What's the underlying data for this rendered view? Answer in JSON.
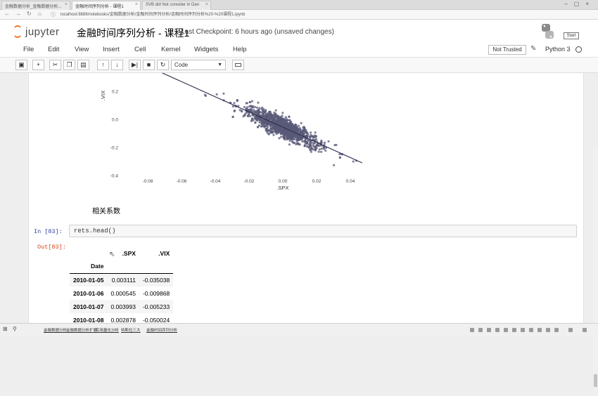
{
  "browser": {
    "tabs": [
      {
        "label": "金融数据分析_金融数据分析..."
      },
      {
        "label": "金融时间序列分析 - 课程1"
      },
      {
        "label": "SVB did Not consider in Dan"
      }
    ],
    "url": "localhost:8888/notebooks/金融数据分析/金融时间序列分析/金融时间序列分析%20-%20课程1.ipynb"
  },
  "jupyter": {
    "logo_text": "jupyter",
    "notebook_title": "金融时间序列分析 - 课程1",
    "checkpoint": "Last Checkpoint: 6 hours ago (unsaved changes)",
    "start_label": "Start",
    "menus": [
      "File",
      "Edit",
      "View",
      "Insert",
      "Cell",
      "Kernel",
      "Widgets",
      "Help"
    ],
    "trust_label": "Not Trusted",
    "kernel_name": "Python 3",
    "cell_type": "Code",
    "toolbar_icons": [
      "save-icon",
      "add-cell-icon",
      "cut-icon",
      "copy-icon",
      "paste-icon",
      "move-up-icon",
      "move-down-icon",
      "run-icon",
      "stop-icon",
      "restart-icon",
      "keyboard-icon"
    ]
  },
  "chart_data": {
    "type": "scatter",
    "xlabel": ".SPX",
    "ylabel": ".VIX",
    "xlim": [
      -0.095,
      0.06
    ],
    "ylim": [
      -0.42,
      0.33
    ],
    "xticks": [
      "-0.08",
      "-0.06",
      "-0.04",
      "-0.02",
      "0.00",
      "0.02",
      "0.04"
    ],
    "xtick_values": [
      -0.08,
      -0.06,
      -0.04,
      -0.02,
      0.0,
      0.02,
      0.04
    ],
    "yticks": [
      "-0.4",
      "-0.2",
      "0.0",
      "0.2"
    ],
    "ytick_values": [
      -0.4,
      -0.2,
      0.0,
      0.2
    ],
    "regression_line": {
      "x": [
        -0.075,
        0.047
      ],
      "y": [
        0.35,
        -0.31
      ]
    },
    "point_color": "#5a5a78",
    "line_color": "#2b2b4a",
    "grid": false
  },
  "cells": {
    "markdown": "相关系数",
    "in_prompt": "In [83]:",
    "code": "rets.head()",
    "out_prompt": "Out[83]:",
    "table": {
      "columns": [
        ".SPX",
        ".VIX"
      ],
      "index_name": "Date",
      "rows": [
        {
          "date": "2010-01-05",
          "spx": "0.003111",
          "vix": "-0.035038"
        },
        {
          "date": "2010-01-06",
          "spx": "0.000545",
          "vix": "-0.009868"
        },
        {
          "date": "2010-01-07",
          "spx": "0.003993",
          "vix": "-0.005233"
        },
        {
          "date": "2010-01-08",
          "spx": "0.002878",
          "vix": "-0.050024"
        }
      ]
    }
  },
  "taskbar": {
    "items": [
      "金融数据分析",
      "金融数据分析扩展",
      "实用量化分析",
      "特斯拉三大",
      "金融时间序列分析"
    ]
  }
}
